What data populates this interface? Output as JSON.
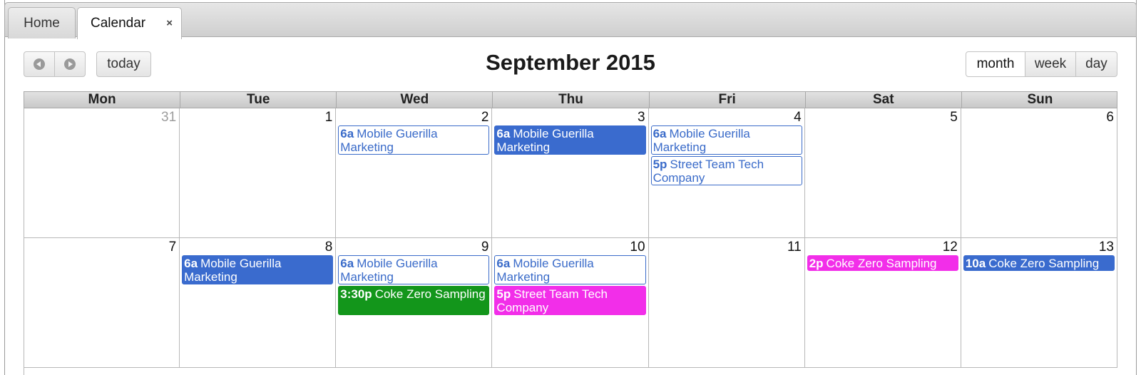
{
  "tabs": {
    "home": "Home",
    "calendar": "Calendar",
    "close_glyph": "×"
  },
  "toolbar": {
    "today": "today",
    "month": "month",
    "week": "week",
    "day": "day"
  },
  "calendar": {
    "title": "September 2015",
    "weekdays": [
      "Mon",
      "Tue",
      "Wed",
      "Thu",
      "Fri",
      "Sat",
      "Sun"
    ],
    "weeks": [
      {
        "days": [
          {
            "num": "31",
            "other": true,
            "events": []
          },
          {
            "num": "1",
            "events": []
          },
          {
            "num": "2",
            "events": [
              {
                "time": "6a",
                "title": "Mobile Guerilla Marketing",
                "style": "outline"
              }
            ]
          },
          {
            "num": "3",
            "events": [
              {
                "time": "6a",
                "title": "Mobile Guerilla Marketing",
                "style": "blue"
              }
            ]
          },
          {
            "num": "4",
            "events": [
              {
                "time": "6a",
                "title": "Mobile Guerilla Marketing",
                "style": "outline"
              },
              {
                "time": "5p",
                "title": "Street Team Tech Company",
                "style": "outline"
              }
            ]
          },
          {
            "num": "5",
            "events": []
          },
          {
            "num": "6",
            "events": []
          }
        ]
      },
      {
        "days": [
          {
            "num": "7",
            "events": []
          },
          {
            "num": "8",
            "events": [
              {
                "time": "6a",
                "title": "Mobile Guerilla Marketing",
                "style": "blue"
              }
            ]
          },
          {
            "num": "9",
            "events": [
              {
                "time": "6a",
                "title": "Mobile Guerilla Marketing",
                "style": "outline"
              },
              {
                "time": "3:30p",
                "title": "Coke Zero Sampling",
                "style": "green"
              }
            ]
          },
          {
            "num": "10",
            "events": [
              {
                "time": "6a",
                "title": "Mobile Guerilla Marketing",
                "style": "outline"
              },
              {
                "time": "5p",
                "title": "Street Team Tech Company",
                "style": "pink"
              }
            ]
          },
          {
            "num": "11",
            "events": []
          },
          {
            "num": "12",
            "events": [
              {
                "time": "2p",
                "title": "Coke Zero Sampling",
                "style": "pink"
              }
            ]
          },
          {
            "num": "13",
            "events": [
              {
                "time": "10a",
                "title": "Coke Zero Sampling",
                "style": "blue"
              }
            ]
          }
        ]
      }
    ]
  },
  "colors": {
    "event_blue": "#3a6bce",
    "event_pink": "#f22ee9",
    "event_green": "#13961b"
  }
}
